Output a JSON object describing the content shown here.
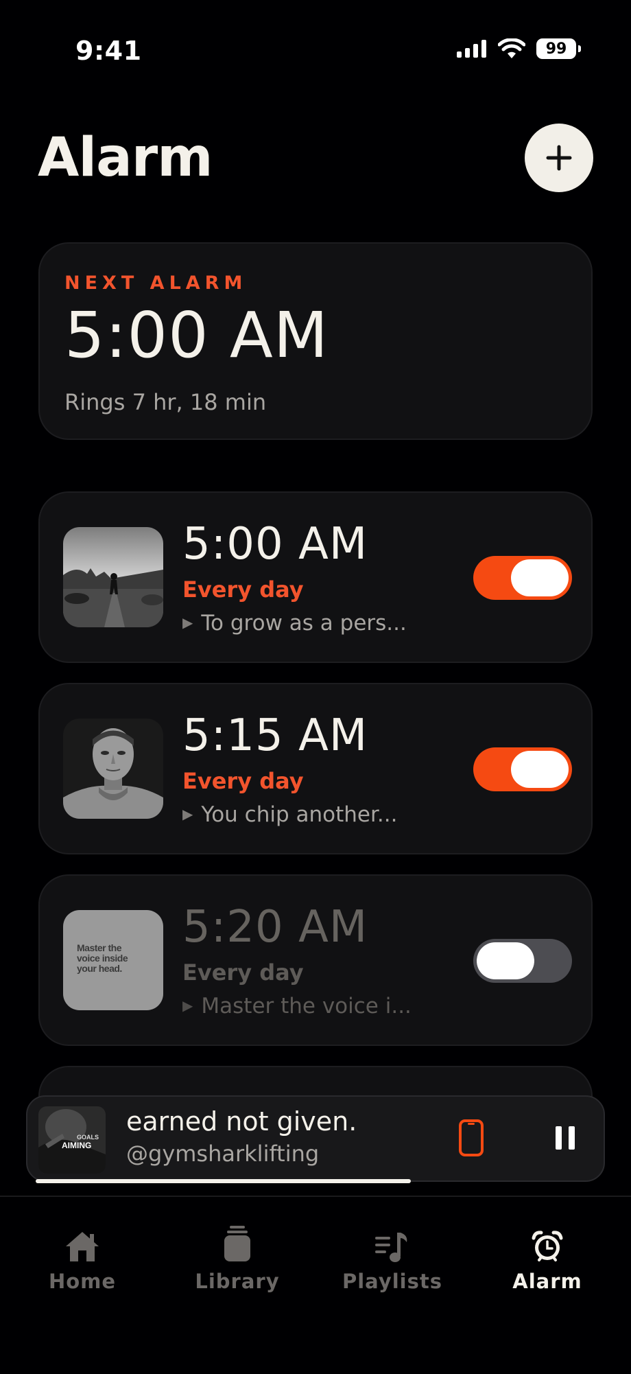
{
  "status_bar": {
    "time": "9:41",
    "battery": "99"
  },
  "header": {
    "title": "Alarm",
    "add_icon": "plus-icon"
  },
  "next_alarm": {
    "label": "NEXT ALARM",
    "time": "5:00 AM",
    "subtitle": "Rings 7 hr, 18 min"
  },
  "alarms": [
    {
      "time": "5:00 AM",
      "repeat": "Every day",
      "track": "To grow as a pers...",
      "enabled": true
    },
    {
      "time": "5:15 AM",
      "repeat": "Every day",
      "track": "You chip another...",
      "enabled": true
    },
    {
      "time": "5:20 AM",
      "repeat": "Every day",
      "track": "Master the voice i...",
      "enabled": false,
      "artwork_text": "Master the voice inside your head."
    }
  ],
  "now_playing": {
    "title": "earned not given.",
    "artist": "@gymsharklifting",
    "progress": 0.67,
    "artwork_text_1": "GOALS",
    "artwork_text_2": "AIMING"
  },
  "tabs": [
    {
      "label": "Home",
      "icon": "home-icon",
      "active": false
    },
    {
      "label": "Library",
      "icon": "library-icon",
      "active": false
    },
    {
      "label": "Playlists",
      "icon": "playlists-icon",
      "active": false
    },
    {
      "label": "Alarm",
      "icon": "alarm-clock-icon",
      "active": true
    }
  ],
  "colors": {
    "accent": "#f54a12",
    "accent_text": "#f2542d",
    "background": "#000002",
    "card": "#111113"
  }
}
